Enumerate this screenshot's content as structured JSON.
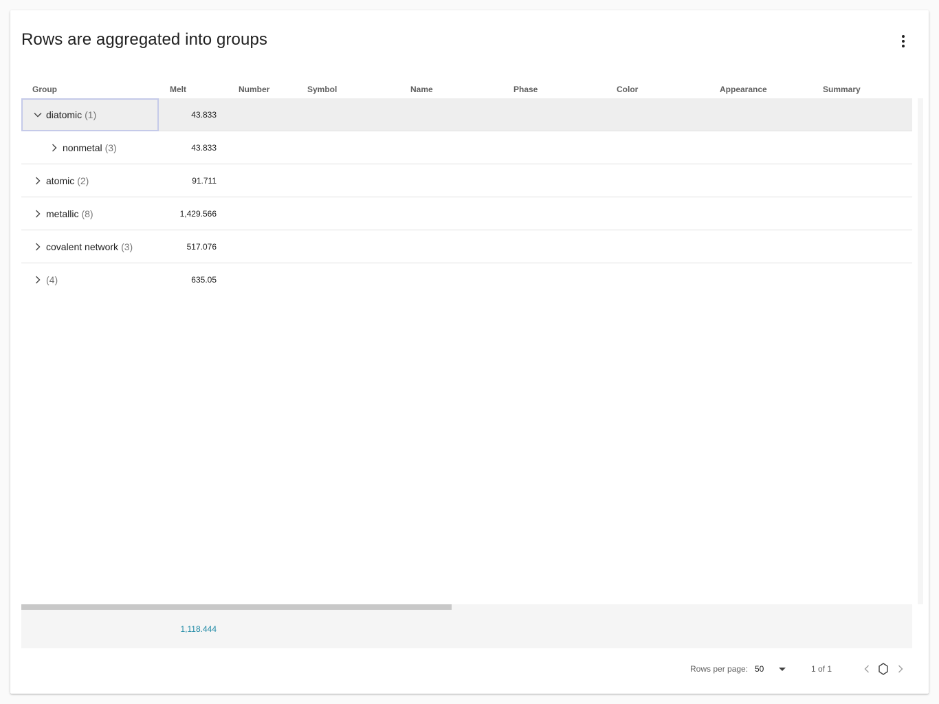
{
  "title": "Rows are aggregated into groups",
  "menu": {
    "icon": "more-vertical-icon"
  },
  "columns": [
    "Group",
    "Melt",
    "Number",
    "Symbol",
    "Name",
    "Phase",
    "Color",
    "Appearance",
    "Summary"
  ],
  "rows": [
    {
      "label": "diatomic",
      "count": "(1)",
      "melt": "43.833",
      "expanded": true,
      "level": 0
    },
    {
      "label": "nonmetal",
      "count": "(3)",
      "melt": "43.833",
      "expanded": false,
      "level": 1
    },
    {
      "label": "atomic",
      "count": "(2)",
      "melt": "91.711",
      "expanded": false,
      "level": 0
    },
    {
      "label": "metallic",
      "count": "(8)",
      "melt": "1,429.566",
      "expanded": false,
      "level": 0
    },
    {
      "label": "covalent network",
      "count": "(3)",
      "melt": "517.076",
      "expanded": false,
      "level": 0
    },
    {
      "label": "",
      "count": "(4)",
      "melt": "635.05",
      "expanded": false,
      "level": 0
    }
  ],
  "footer": {
    "melt_total": "1,118.444"
  },
  "pagination": {
    "rows_per_page_label": "Rows per page:",
    "rows_per_page_value": "50",
    "range": "1 of 1"
  },
  "colors": {
    "accent_total": "#1f8aa6",
    "active_row": "#eeeeee",
    "focus_outline": "#c5cae9"
  }
}
